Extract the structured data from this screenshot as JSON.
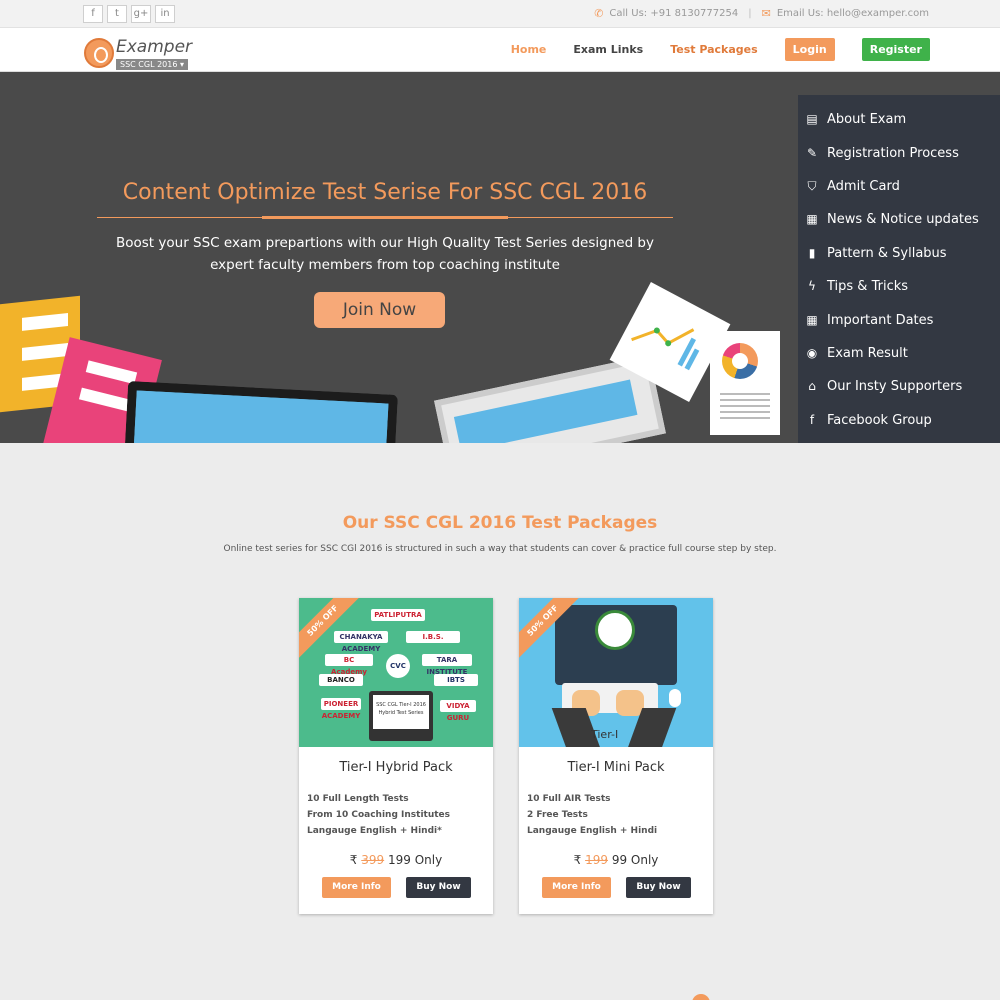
{
  "colors": {
    "accent": "#f39a5c",
    "success": "#3fb24a",
    "dark": "#333842",
    "hero_bg": "#4a4a4a"
  },
  "topbar": {
    "social": [
      {
        "icon": "facebook-icon",
        "glyph": "f"
      },
      {
        "icon": "twitter-icon",
        "glyph": "t"
      },
      {
        "icon": "googleplus-icon",
        "glyph": "g+"
      },
      {
        "icon": "linkedin-icon",
        "glyph": "in"
      }
    ],
    "call": "Call Us: +91 8130777254",
    "email": "Email Us: hello@examper.com",
    "separator": "|"
  },
  "nav": {
    "brand": "Examper",
    "exam_select": "SSC CGL 2016 ▾",
    "links": [
      "Home",
      "Exam Links",
      "Test Packages"
    ],
    "login": "Login",
    "register": "Register"
  },
  "hero": {
    "title": "Content Optimize Test Serise For SSC CGL 2016",
    "text": "Boost your SSC exam prepartions with our High Quality Test Series designed by expert faculty members from top coaching institute",
    "cta": "Join Now"
  },
  "side_menu": [
    {
      "label": "About Exam",
      "icon": "document-icon",
      "glyph": "▤"
    },
    {
      "label": "Registration Process",
      "icon": "edit-icon",
      "glyph": "✎"
    },
    {
      "label": "Admit Card",
      "icon": "bookmark-icon",
      "glyph": "⛉"
    },
    {
      "label": "News & Notice updates",
      "icon": "newspaper-icon",
      "glyph": "▦"
    },
    {
      "label": "Pattern & Syllabus",
      "icon": "book-icon",
      "glyph": "▮"
    },
    {
      "label": "Tips & Tricks",
      "icon": "bolt-icon",
      "glyph": "ϟ"
    },
    {
      "label": "Important Dates",
      "icon": "calendar-icon",
      "glyph": "▦"
    },
    {
      "label": "Exam Result",
      "icon": "target-icon",
      "glyph": "◉"
    },
    {
      "label": "Our Insty Supporters",
      "icon": "institution-icon",
      "glyph": "⌂"
    },
    {
      "label": "Facebook Group",
      "icon": "facebook-icon",
      "glyph": "f"
    }
  ],
  "packages": {
    "title": "Our SSC CGL 2016 Test Packages",
    "subtitle": "Online test series for SSC CGl 2016 is structured in such a way that students can cover & practice full course step by step.",
    "cards": [
      {
        "ribbon": "50% OFF",
        "name": "Tier-I Hybrid Pack",
        "features": [
          "10 Full Length Tests",
          "From 10 Coaching Institutes",
          "Langauge English + Hindi*"
        ],
        "currency": "₹",
        "old_price": "399",
        "new_price": "199 Only",
        "more": "More Info",
        "buy": "Buy Now",
        "image_logos": [
          "PATLIPUTRA",
          "CHANAKYA ACADEMY",
          "I.B.S.",
          "BC Academy",
          "CVC",
          "TARA INSTITUTE",
          "BANCO",
          "IBTS",
          "PIONEER ACADEMY",
          "VIDYA GURU"
        ],
        "image_laptop": "SSC CGL Tier-I 2016 Hybrid Test Series"
      },
      {
        "ribbon": "50% OFF",
        "name": "Tier-I Mini Pack",
        "features": [
          "10 Full AIR Tests",
          "2 Free Tests",
          "Langauge English + Hindi"
        ],
        "currency": "₹",
        "old_price": "199",
        "new_price": "99 Only",
        "more": "More Info",
        "buy": "Buy Now",
        "image_tier": "Tier-I"
      }
    ]
  }
}
